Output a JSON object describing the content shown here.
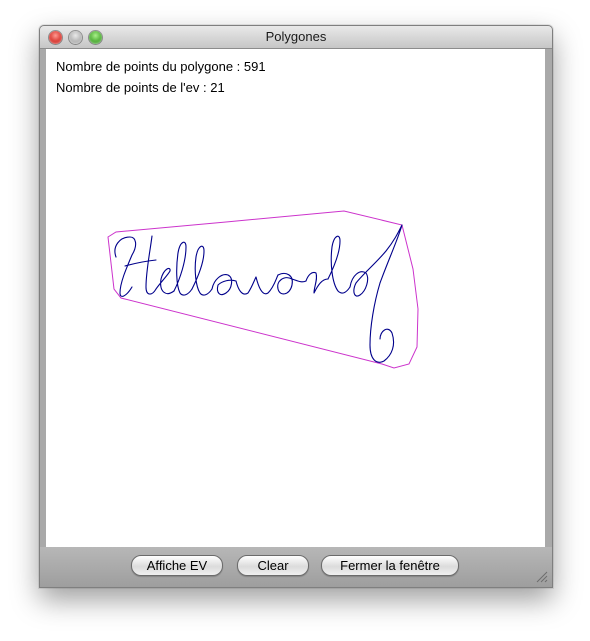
{
  "window": {
    "title": "Polygones"
  },
  "canvas": {
    "info_points_polygon": "Nombre de points du polygone : 591",
    "info_points_ev": "Nombre de points de l'ev : 21",
    "handwriting_text": "Helloworld",
    "stroke_color": "#00008b",
    "hull_color": "#cc33cc"
  },
  "buttons": {
    "affiche_ev": "Affiche EV",
    "clear": "Clear",
    "fermer": "Fermer la fenêtre"
  }
}
